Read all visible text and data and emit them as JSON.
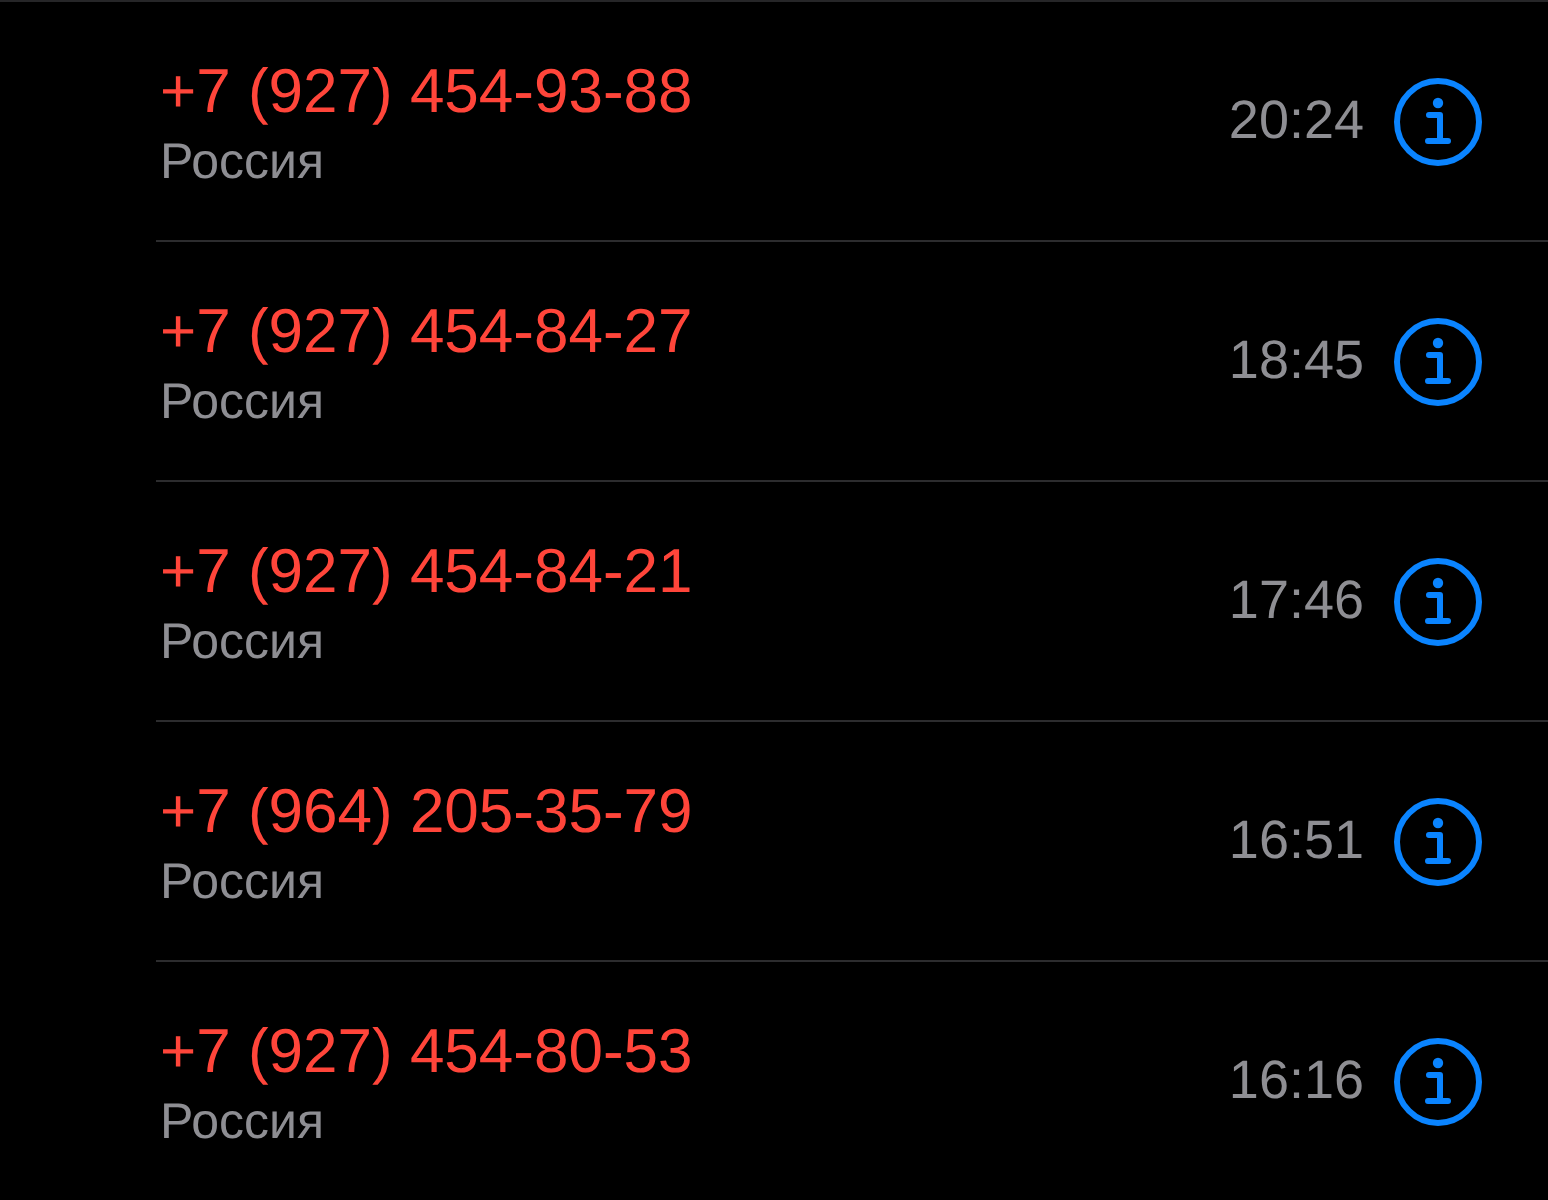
{
  "calls": [
    {
      "number": "+7 (927) 454-93-88",
      "location": "Россия",
      "time": "20:24",
      "missed": true
    },
    {
      "number": "+7 (927) 454-84-27",
      "location": "Россия",
      "time": "18:45",
      "missed": true
    },
    {
      "number": "+7 (927) 454-84-21",
      "location": "Россия",
      "time": "17:46",
      "missed": true
    },
    {
      "number": "+7 (964) 205-35-79",
      "location": "Россия",
      "time": "16:51",
      "missed": true
    },
    {
      "number": "+7 (927) 454-80-53",
      "location": "Россия",
      "time": "16:16",
      "missed": true
    }
  ]
}
